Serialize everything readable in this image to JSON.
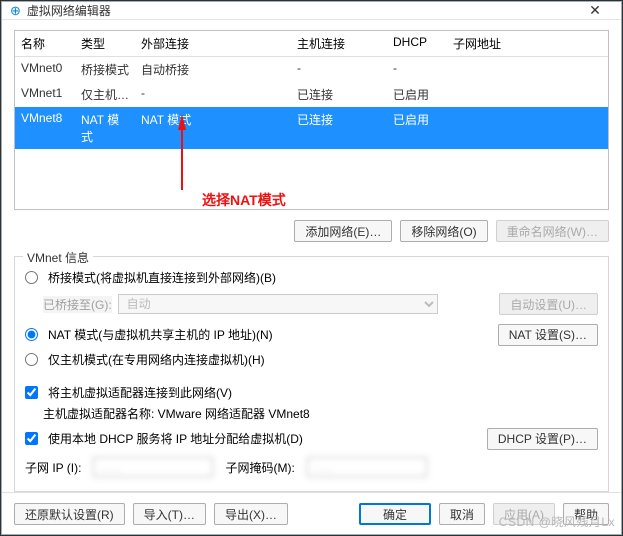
{
  "title": "虚拟网络编辑器",
  "table": {
    "headers": [
      "名称",
      "类型",
      "外部连接",
      "主机连接",
      "DHCP",
      "子网地址"
    ],
    "rows": [
      {
        "name": "VMnet0",
        "type": "桥接模式",
        "ext": "自动桥接",
        "host": "-",
        "dhcp": "-",
        "subnet": ""
      },
      {
        "name": "VMnet1",
        "type": "仅主机…",
        "ext": "-",
        "host": "已连接",
        "dhcp": "已启用",
        "subnet": "            "
      },
      {
        "name": "VMnet8",
        "type": "NAT 模式",
        "ext": "NAT 模式",
        "host": "已连接",
        "dhcp": "已启用",
        "subnet": "            "
      }
    ]
  },
  "annotation": "选择NAT模式",
  "buttons": {
    "add": "添加网络(E)…",
    "remove": "移除网络(O)",
    "rename": "重命名网络(W)…",
    "restore": "还原默认设置(R)",
    "import": "导入(T)…",
    "export": "导出(X)…",
    "ok": "确定",
    "cancel": "取消",
    "apply": "应用(A)",
    "help": "帮助"
  },
  "group": {
    "legend": "VMnet 信息",
    "bridge_label": "桥接模式(将虚拟机直接连接到外部网络)(B)",
    "bridge_to_label": "已桥接至(G):",
    "bridge_to_value": "自动",
    "bridge_auto_btn": "自动设置(U)…",
    "nat_label": "NAT 模式(与虚拟机共享主机的 IP 地址)(N)",
    "nat_btn": "NAT 设置(S)…",
    "hostonly_label": "仅主机模式(在专用网络内连接虚拟机)(H)",
    "connect_host_label": "将主机虚拟适配器连接到此网络(V)",
    "adapter_caption": "主机虚拟适配器名称: VMware 网络适配器 VMnet8",
    "dhcp_label": "使用本地 DHCP 服务将 IP 地址分配给虚拟机(D)",
    "dhcp_btn": "DHCP 设置(P)…",
    "subnet_ip_label": "子网 IP (I):",
    "subnet_ip_value": " . . . ",
    "subnet_mask_label": "子网掩码(M):",
    "subnet_mask_value": " . . . "
  },
  "watermark": "CSDN @晓风残月Lx"
}
